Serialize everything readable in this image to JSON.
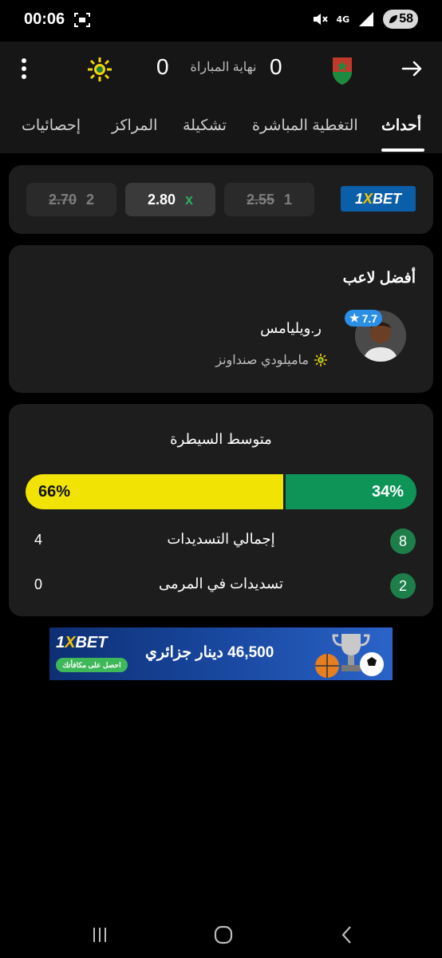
{
  "status_bar": {
    "time": "00:06",
    "network": "4G",
    "battery": "58",
    "icons": [
      "screenshot-icon",
      "mute-icon",
      "network-icon",
      "signal-icon",
      "battery-icon"
    ]
  },
  "match": {
    "status": "نهاية المباراة",
    "home_score": "0",
    "away_score": "0",
    "home_team_logo": "team-logo-red-green",
    "away_team_logo": "sundowns-logo"
  },
  "tabs": [
    {
      "label": "أحداث",
      "active": true
    },
    {
      "label": "التغطية المباشرة",
      "active": false
    },
    {
      "label": "تشكيلة",
      "active": false
    },
    {
      "label": "المراكز",
      "active": false
    },
    {
      "label": "إحصائيات",
      "active": false
    }
  ],
  "odds": {
    "provider": {
      "left": "1",
      "right": "BET",
      "x": "X"
    },
    "options": [
      {
        "label": "1",
        "value": "2.55"
      },
      {
        "label": "x",
        "value": "2.80"
      },
      {
        "label": "2",
        "value": "2.70"
      }
    ]
  },
  "best_player": {
    "title": "أفضل لاعب",
    "name": "ر.ويليامس",
    "team": "ماميلودي صنداونز",
    "rating": "7.7"
  },
  "stats": {
    "possession_title": "متوسط السيطرة",
    "possession_home": 34,
    "possession_away": 66,
    "possession_home_text": "34%",
    "possession_away_text": "66%",
    "rows": [
      {
        "label": "إجمالي التسديدات",
        "home": "8",
        "away": "4"
      },
      {
        "label": "تسديدات في المرمى",
        "home": "2",
        "away": "0"
      }
    ]
  },
  "ad": {
    "brand_left": "1",
    "brand_x": "X",
    "brand_right": "BET",
    "cta": "احصل على مكافأتك",
    "text": "46,500 دينار جزائري"
  },
  "colors": {
    "accent_green": "#0f9458",
    "accent_yellow": "#f1e404",
    "rating_blue": "#2b8fe6",
    "brand_blue": "#0b5ea8"
  }
}
